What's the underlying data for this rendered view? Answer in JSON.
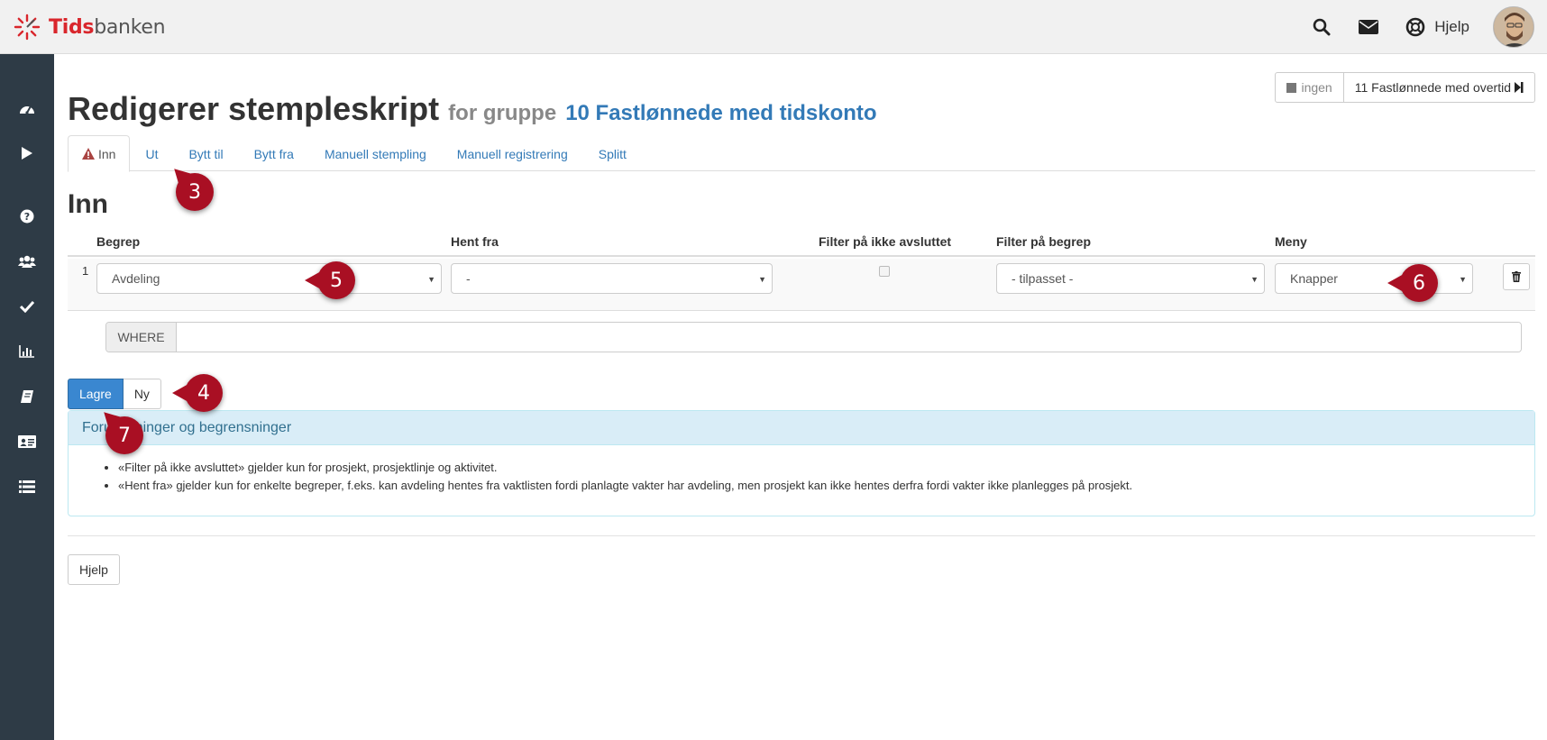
{
  "brand": {
    "name_red": "Tids",
    "name_grey": "banken",
    "accent": "#d9262c"
  },
  "topbar": {
    "search_icon": "search-icon",
    "mail_icon": "envelope-icon",
    "help_label": "Hjelp",
    "help_icon": "life-ring-icon"
  },
  "sidebar": {
    "items": [
      "dashboard-icon",
      "play-icon",
      "question-icon",
      "users-icon",
      "check-icon",
      "bar-chart-icon",
      "book-icon",
      "id-card-icon",
      "list-icon"
    ]
  },
  "group_switch": {
    "none_label": "ingen",
    "current_label": "11 Fastlønnede med overtid"
  },
  "page": {
    "title": "Redigerer stempleskript",
    "subtitle": "for gruppe",
    "group": "10 Fastlønnede med tidskonto"
  },
  "tabs": [
    {
      "label": "Inn",
      "active": true
    },
    {
      "label": "Ut"
    },
    {
      "label": "Bytt til"
    },
    {
      "label": "Bytt fra"
    },
    {
      "label": "Manuell stempling"
    },
    {
      "label": "Manuell registrering"
    },
    {
      "label": "Splitt"
    }
  ],
  "section_title": "Inn",
  "table": {
    "headers": {
      "begrep": "Begrep",
      "hent_fra": "Hent fra",
      "filter_ikke_avsluttet": "Filter på ikke avsluttet",
      "filter_begrep": "Filter på begrep",
      "meny": "Meny"
    },
    "rows": [
      {
        "num": "1",
        "begrep": "Avdeling",
        "hent_fra": "-",
        "filter_ikke_avsluttet": false,
        "filter_begrep": "- tilpasset -",
        "meny": "Knapper"
      }
    ]
  },
  "where": {
    "label": "WHERE",
    "value": ""
  },
  "buttons": {
    "save": "Lagre",
    "new": "Ny",
    "help": "Hjelp"
  },
  "panel": {
    "title": "Forutsetninger og begrensninger",
    "items": [
      "«Filter på ikke avsluttet» gjelder kun for prosjekt, prosjektlinje og aktivitet.",
      "«Hent fra» gjelder kun for enkelte begreper, f.eks. kan avdeling hentes fra vaktlisten fordi planlagte vakter har avdeling, men prosjekt kan ikke hentes derfra fordi vakter ikke planlegges på prosjekt."
    ]
  },
  "markers": {
    "m3": "3",
    "m4": "4",
    "m5": "5",
    "m6": "6",
    "m7": "7"
  }
}
